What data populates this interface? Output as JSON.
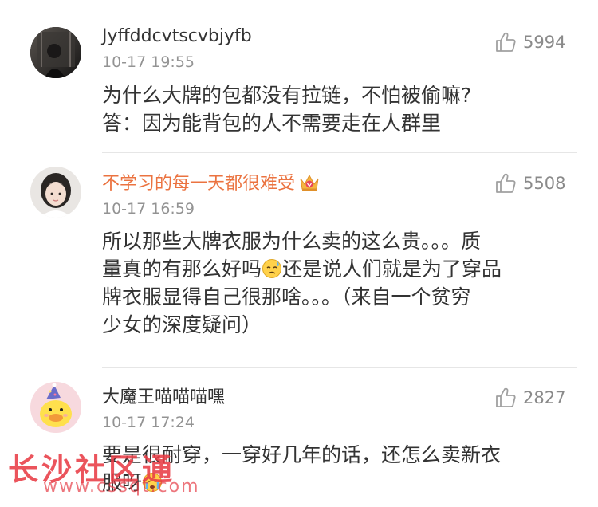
{
  "comments": [
    {
      "username": "Jyffddcvtscvbjyfb",
      "time": "10-17 19:55",
      "likes": "5994",
      "lines": [
        "为什么大牌的包都没有拉链，不怕被偷嘛?",
        "答：因为能背包的人不需要走在人群里"
      ]
    },
    {
      "username": "不学习的每一天都很难受",
      "badge_icon": "crown-icon",
      "time": "10-17 16:59",
      "likes": "5508",
      "line1_before_emoji": "所以那些大牌衣服为什么卖的这么贵。。。质",
      "line2_before_emoji": "量真的有那么好吗",
      "emoji_icon": "sweat-emoji-icon",
      "line2_after_emoji": "还是说人们就是为了穿品",
      "line3": "牌衣服显得自己很那啥。。。（来自一个贫穷",
      "line4": "少女的深度疑问）"
    },
    {
      "username": "大魔王喵喵喵嘿",
      "time": "10-17 17:24",
      "likes": "2827",
      "line1": "要是很耐穿，一穿好几年的话，还怎么卖新衣",
      "line2": "服呀",
      "emoji_icon": "cry-emoji-icon"
    }
  ],
  "watermark": {
    "title": "长沙社区通",
    "url": "www.cssqt.com"
  },
  "colors": {
    "vip_name": "#eb7340",
    "name": "#333333",
    "meta": "#939393",
    "watermark": "#e83c46"
  }
}
